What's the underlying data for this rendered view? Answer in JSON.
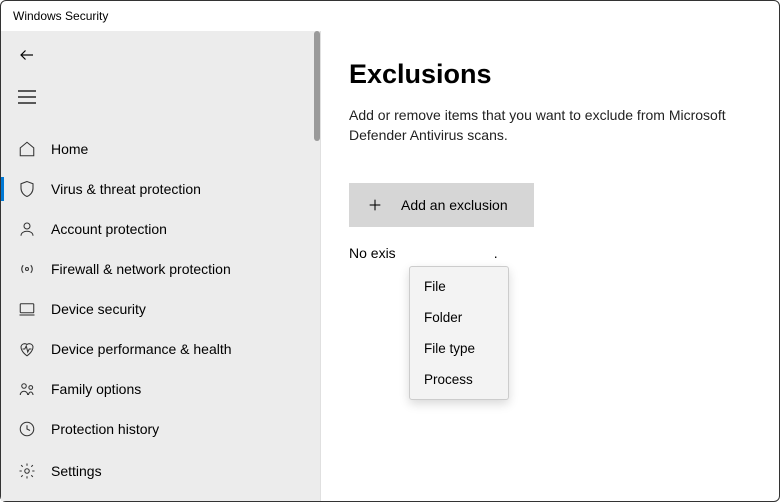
{
  "window": {
    "title": "Windows Security"
  },
  "sidebar": {
    "nav": {
      "home": "Home",
      "virus": "Virus & threat protection",
      "account": "Account protection",
      "firewall": "Firewall & network protection",
      "device": "Device security",
      "performance": "Device performance & health",
      "family": "Family options",
      "history": "Protection history"
    },
    "settings": "Settings"
  },
  "main": {
    "title": "Exclusions",
    "description": "Add or remove items that you want to exclude from Microsoft Defender Antivirus scans.",
    "addButton": "Add an exclusion",
    "status": "No exis",
    "statusSuffix": "."
  },
  "dropdown": {
    "file": "File",
    "folder": "Folder",
    "filetype": "File type",
    "process": "Process"
  }
}
